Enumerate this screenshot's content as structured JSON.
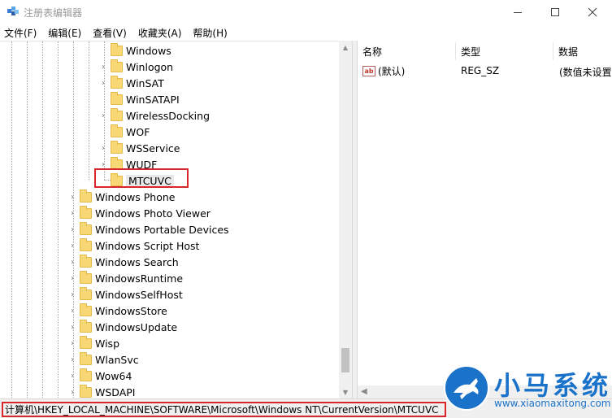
{
  "window": {
    "title": "注册表编辑器",
    "minimize": "—",
    "maximize": "□",
    "close": "✕"
  },
  "menu": [
    "文件(F)",
    "编辑(E)",
    "查看(V)",
    "收藏夹(A)",
    "帮助(H)"
  ],
  "tree": {
    "child_items": [
      {
        "label": "Windows",
        "expandable": false
      },
      {
        "label": "Winlogon",
        "expandable": true
      },
      {
        "label": "WinSAT",
        "expandable": true
      },
      {
        "label": "WinSATAPI",
        "expandable": false
      },
      {
        "label": "WirelessDocking",
        "expandable": true
      },
      {
        "label": "WOF",
        "expandable": false
      },
      {
        "label": "WSService",
        "expandable": true
      },
      {
        "label": "WUDF",
        "expandable": true
      },
      {
        "label": "MTCUVC",
        "expandable": false,
        "selected": true
      }
    ],
    "sibling_items": [
      {
        "label": "Windows Phone"
      },
      {
        "label": "Windows Photo Viewer"
      },
      {
        "label": "Windows Portable Devices"
      },
      {
        "label": "Windows Script Host"
      },
      {
        "label": "Windows Search"
      },
      {
        "label": "WindowsRuntime"
      },
      {
        "label": "WindowsSelfHost"
      },
      {
        "label": "WindowsStore"
      },
      {
        "label": "WindowsUpdate"
      },
      {
        "label": "Wisp"
      },
      {
        "label": "WlanSvc"
      },
      {
        "label": "Wow64"
      },
      {
        "label": "WSDAPI"
      }
    ]
  },
  "values_table": {
    "headers": {
      "name": "名称",
      "type": "类型",
      "data": "数据"
    },
    "rows": [
      {
        "name": "(默认)",
        "type": "REG_SZ",
        "data": "(数值未设置)",
        "icon": "ab-string-icon"
      }
    ]
  },
  "status": {
    "path": "计算机\\HKEY_LOCAL_MACHINE\\SOFTWARE\\Microsoft\\Windows NT\\CurrentVersion\\MTCUVC"
  },
  "watermark": {
    "title": "小马系统",
    "url": "www.xiaomaxitong.com"
  },
  "colors": {
    "highlight": "#d9262b",
    "folder": "#f8d775",
    "watermark": "#1a73c9"
  }
}
